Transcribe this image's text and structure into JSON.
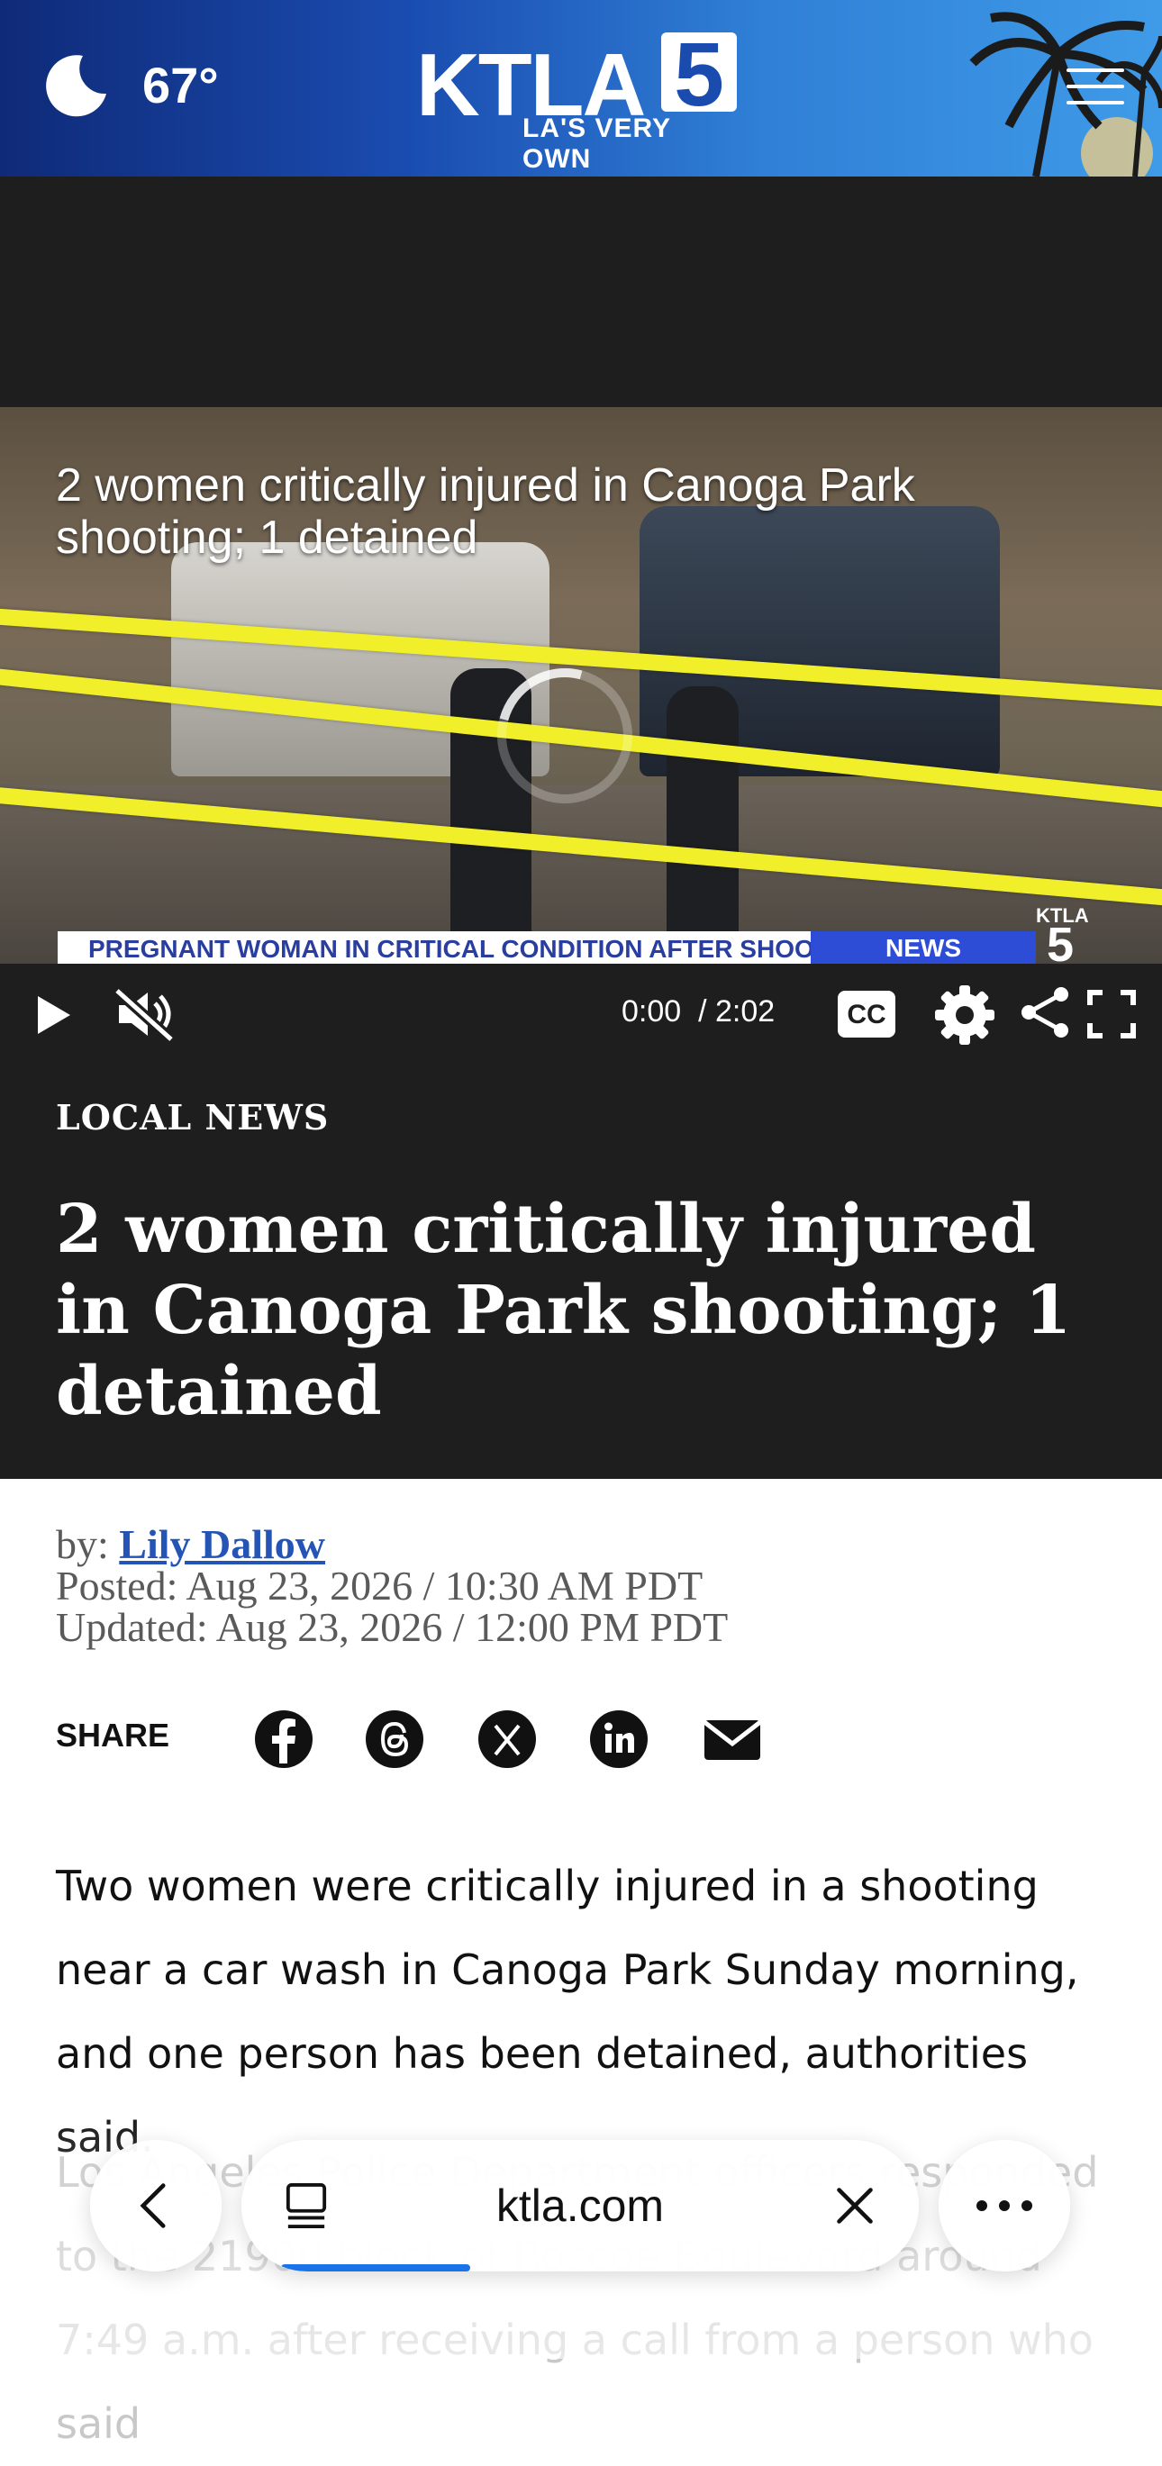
{
  "header": {
    "temperature": "67°",
    "logo_letters": "KTLA",
    "logo_number": "5",
    "logo_tagline": "LA'S VERY OWN"
  },
  "video": {
    "title": "2 women critically injured in Canoga Park shooting; 1 detained",
    "ticker": "PREGNANT WOMAN IN CRITICAL CONDITION AFTER SHOOTING",
    "badge": "NEWS",
    "bug_text": "KTLA",
    "bug_number": "5",
    "current_time": "0:00",
    "duration": "/ 2:02",
    "cc_label": "CC"
  },
  "article": {
    "section": "LOCAL NEWS",
    "headline": "2 women critically injured in Canoga Park shooting; 1 detained",
    "byline_prefix": "by: ",
    "author": "Lily Dallow",
    "posted": "Posted: Aug 23, 2026 / 10:30 AM PDT",
    "updated": "Updated: Aug 23, 2026 / 12:00 PM PDT",
    "share_label": "SHARE",
    "paragraph1": "Two women were critically injured in a shooting near a car wash in Canoga Park Sunday morning, and one person has been detained, authorities said.",
    "paragraph2_partial": "Los Angeles Police Department officers responded to the 21900 block of Roscoe Boulevard around 7:49 a.m. after receiving a call from a person who said"
  },
  "browser": {
    "url": "ktla.com"
  },
  "colors": {
    "header_blue": "#1a4cb0",
    "dark_bg": "#1e1e1f",
    "link_blue": "#2454b5",
    "ticker_blue": "#2e4dd6",
    "progress_blue": "#1a73e8"
  },
  "icons": [
    "moon-icon",
    "menu-icon",
    "play-icon",
    "muted-icon",
    "cc-icon",
    "gear-icon",
    "share-icon",
    "fullscreen-icon",
    "facebook-icon",
    "threads-icon",
    "x-icon",
    "linkedin-icon",
    "email-icon",
    "chevron-left-icon",
    "tabs-icon",
    "close-icon",
    "more-icon"
  ]
}
